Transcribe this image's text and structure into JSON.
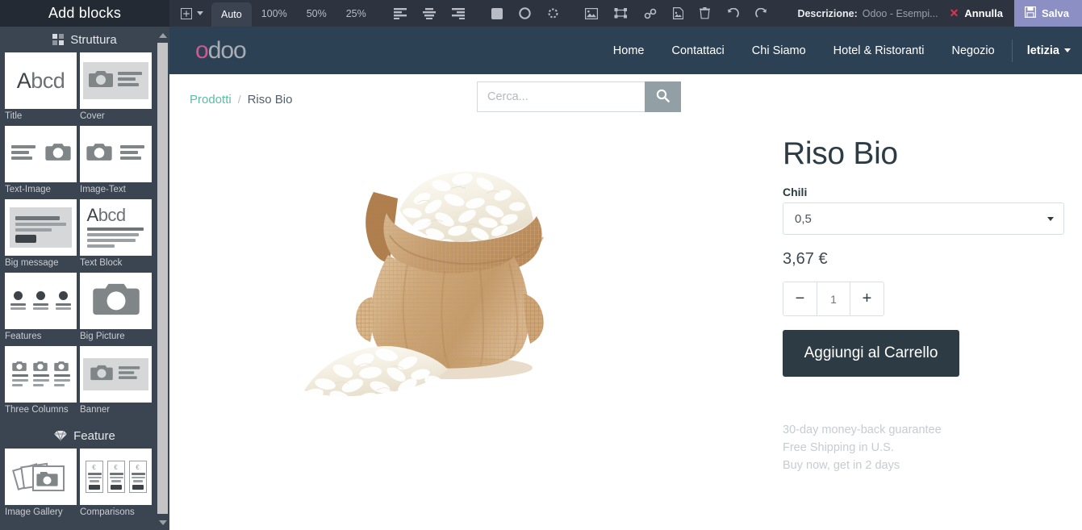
{
  "sidebar": {
    "title": "Add blocks",
    "sections": [
      {
        "name": "Struttura",
        "icon": "grid-icon",
        "blocks": [
          {
            "label": "Title",
            "thumb": "abcd"
          },
          {
            "label": "Cover",
            "thumb": "cam-left-text-right"
          },
          {
            "label": "Text-Image",
            "thumb": "text-left-cam-right"
          },
          {
            "label": "Image-Text",
            "thumb": "cam-left-text-right-plain"
          },
          {
            "label": "Big message",
            "thumb": "big-message"
          },
          {
            "label": "Text Block",
            "thumb": "abcd-lines"
          },
          {
            "label": "Features",
            "thumb": "features"
          },
          {
            "label": "Big Picture",
            "thumb": "big-picture"
          },
          {
            "label": "Three Columns",
            "thumb": "three-columns"
          },
          {
            "label": "Banner",
            "thumb": "banner"
          }
        ]
      },
      {
        "name": "Feature",
        "icon": "diamond-icon",
        "blocks": [
          {
            "label": "Image Gallery",
            "thumb": "image-gallery"
          },
          {
            "label": "Comparisons",
            "thumb": "comparisons"
          }
        ]
      }
    ]
  },
  "toolbar": {
    "layout_icon": "table-insert-icon",
    "layout_caret": "chevron-down-icon",
    "zoom_levels": [
      "Auto",
      "100%",
      "50%",
      "25%"
    ],
    "zoom_active": "Auto",
    "align_icons": [
      "align-left-icon",
      "align-center-icon",
      "align-right-icon"
    ],
    "shape_icons": [
      "rounded-square-icon",
      "circle-icon",
      "shadow-icon"
    ],
    "action_icons": [
      "image-icon",
      "crop-icon",
      "link-icon",
      "document-image-icon",
      "trash-icon",
      "undo-icon",
      "redo-icon"
    ],
    "description_label": "Descrizione:",
    "description_value": "Odoo - Esempi...",
    "cancel_label": "Annulla",
    "cancel_icon": "close-icon",
    "save_label": "Salva",
    "save_icon": "floppy-disk-icon",
    "save_bg": "#8b8fc4"
  },
  "site": {
    "logo": {
      "first": "o",
      "rest": "doo",
      "accent": "#cd5a94"
    },
    "nav": [
      {
        "label": "Home"
      },
      {
        "label": "Contattaci"
      },
      {
        "label": "Chi Siamo"
      },
      {
        "label": "Hotel & Ristoranti"
      },
      {
        "label": "Negozio"
      }
    ],
    "user": {
      "name": "letizia",
      "caret": "chevron-down-icon"
    },
    "breadcrumb": {
      "root": "Prodotti",
      "separator": "/",
      "current": "Riso Bio"
    },
    "search": {
      "placeholder": "Cerca...",
      "value": "",
      "icon": "search-icon"
    },
    "product": {
      "image_alt": "burlap-sack-of-rice",
      "title": "Riso Bio",
      "attribute_label": "Chili",
      "attribute_value": "0,5",
      "price": "3,67 €",
      "qty_minus": "−",
      "qty_value": "1",
      "qty_plus": "+",
      "add_to_cart": "Aggiungi al Carrello",
      "guarantees": [
        "30-day money-back guarantee",
        "Free Shipping in U.S.",
        "Buy now, get in 2 days"
      ]
    }
  }
}
